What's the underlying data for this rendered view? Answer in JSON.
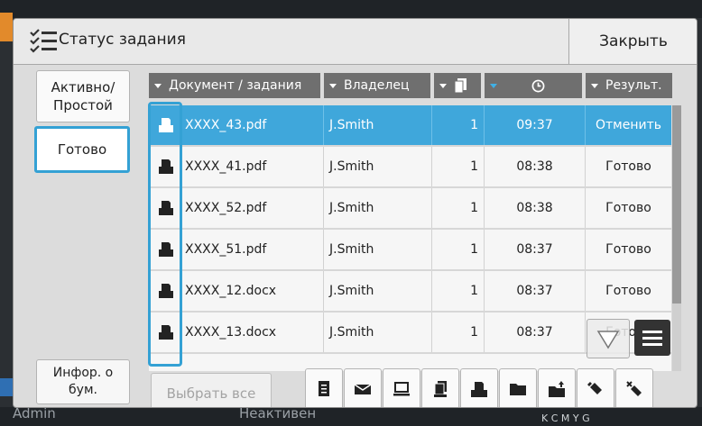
{
  "title_bar": {
    "title": "Статус задания",
    "close_label": "Закрыть"
  },
  "side_tabs": {
    "active_idle": "Активно/ Простой",
    "done": "Готово",
    "paper_info": "Инфор. о бум."
  },
  "columns": {
    "document": "Документ / задания",
    "owner": "Владелец",
    "result": "Результ."
  },
  "rows": [
    {
      "name": "XXXX_43.pdf",
      "owner": "J.Smith",
      "copies": "1",
      "time": "09:37",
      "result": "Отменить",
      "selected": true
    },
    {
      "name": "XXXX_41.pdf",
      "owner": "J.Smith",
      "copies": "1",
      "time": "08:38",
      "result": "Готово"
    },
    {
      "name": "XXXX_52.pdf",
      "owner": "J.Smith",
      "copies": "1",
      "time": "08:38",
      "result": "Готово"
    },
    {
      "name": "XXXX_51.pdf",
      "owner": "J.Smith",
      "copies": "1",
      "time": "08:37",
      "result": "Готово"
    },
    {
      "name": "XXXX_12.docx",
      "owner": "J.Smith",
      "copies": "1",
      "time": "08:37",
      "result": "Готово"
    },
    {
      "name": "XXXX_13.docx",
      "owner": "J.Smith",
      "copies": "1",
      "time": "08:37",
      "result": "Готово"
    }
  ],
  "toolbar": {
    "select_all": "Выбрать все",
    "icons": [
      "copy-job-icon",
      "mail-icon",
      "pc-icon",
      "scan-icon",
      "print-icon",
      "folder-icon",
      "folder-upload-icon",
      "usb-icon",
      "usb-remove-icon"
    ]
  },
  "background": {
    "user": "Admin",
    "status": "Неактивен",
    "ink": "K C M Y G"
  },
  "colors": {
    "accent": "#3fa7db",
    "header": "#6f6f6f"
  }
}
